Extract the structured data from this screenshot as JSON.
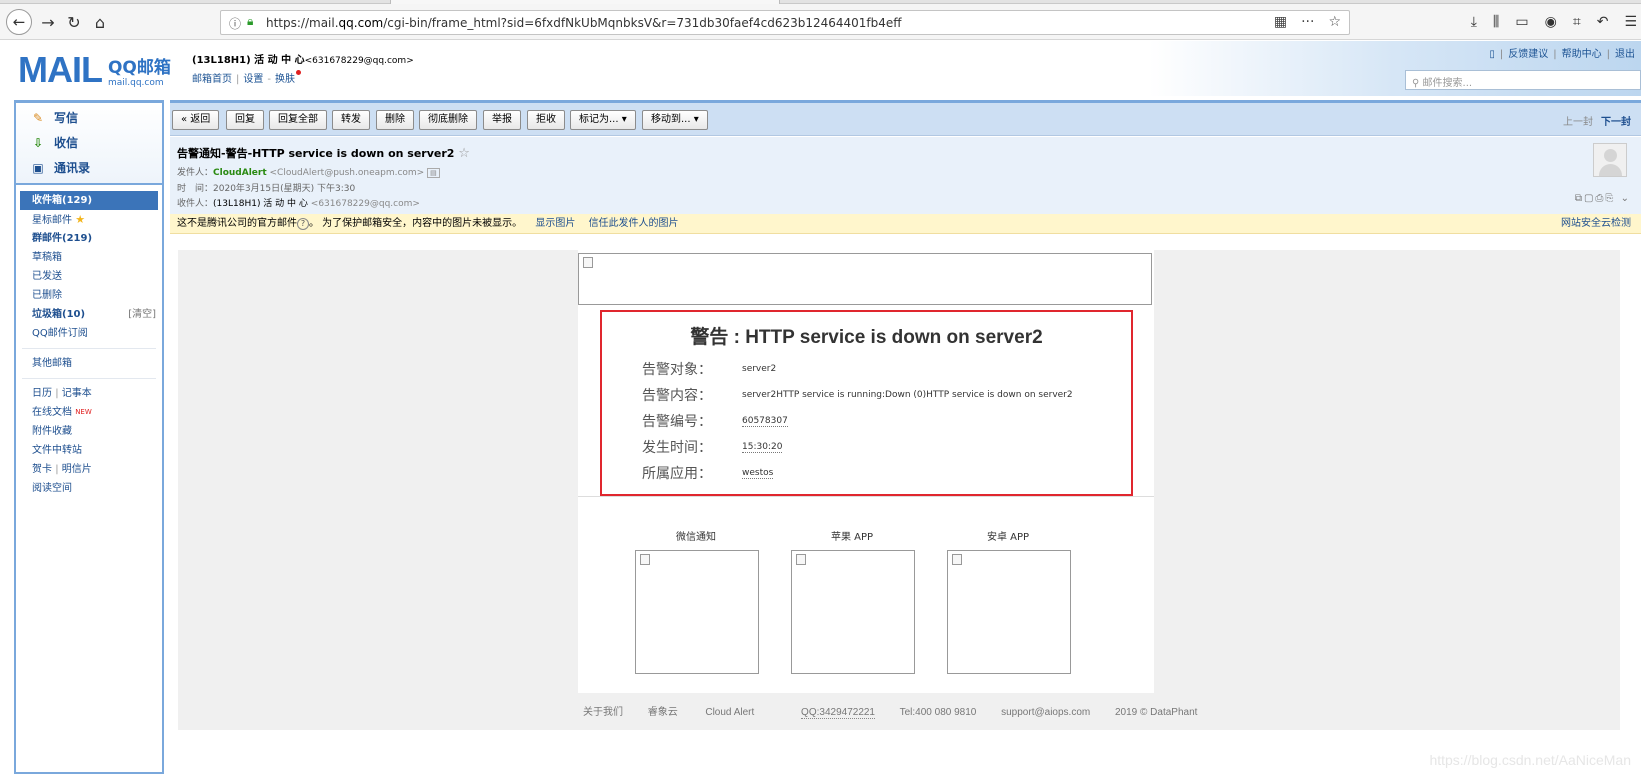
{
  "browser": {
    "url_prefix": "https://mail.",
    "url_domain": "qq.com",
    "url_rest": "/cgi-bin/frame_html?sid=6fxdfNkUbMqnbksV&r=731db30faef4cd623b12464401fb4eff",
    "icons": [
      "back-icon",
      "forward-icon",
      "reload-icon",
      "home-icon",
      "info-icon",
      "lock-icon",
      "qr-icon",
      "more-icon",
      "bookmark-star-icon",
      "download-icon",
      "library-icon",
      "sidebar-icon",
      "sync-icon",
      "crop-icon",
      "undo-icon",
      "menu-icon"
    ]
  },
  "header": {
    "logo_main": "MAIL",
    "logo_cn": "QQ邮箱",
    "logo_domain": "mail.qq.com",
    "user_name": "(13L18H1) 活 动 中 心",
    "user_email": "<631678229@qq.com>",
    "links": [
      "邮箱首页",
      "设置",
      "换肤"
    ],
    "top_links": [
      "反馈建议",
      "帮助中心",
      "退出"
    ],
    "search_placeholder": "邮件搜索..."
  },
  "sidebar": {
    "quick": [
      "写信",
      "收信",
      "通讯录"
    ],
    "inbox": "收件箱(129)",
    "starred": "星标邮件",
    "group": "群邮件(219)",
    "drafts": "草稿箱",
    "sent": "已发送",
    "deleted": "已删除",
    "spam": "垃圾箱(10)",
    "spam_clear": "[清空]",
    "subscription": "QQ邮件订阅",
    "other": "其他邮箱",
    "calendar": "日历",
    "notes": "记事本",
    "docs": "在线文档",
    "docs_badge": "NEW",
    "attachments": "附件收藏",
    "transfer": "文件中转站",
    "cards": "贺卡",
    "postcard": "明信片",
    "reading": "阅读空间"
  },
  "toolbar": {
    "back": "« 返回",
    "reply": "回复",
    "reply_all": "回复全部",
    "forward": "转发",
    "delete": "删除",
    "delete_perm": "彻底删除",
    "report": "举报",
    "reject": "拒收",
    "mark_as": "标记为... ▾",
    "move_to": "移动到... ▾",
    "prev": "上一封",
    "next": "下一封"
  },
  "message": {
    "subject": "告警通知-警告-HTTP service is down on server2",
    "from_label": "发件人：",
    "from_name": "CloudAlert",
    "from_addr": "<CloudAlert@push.oneapm.com>",
    "time_label": "时　间：",
    "time": "2020年3月15日(星期天) 下午3:30",
    "to_label": "收件人：",
    "to_name": "(13L18H1) 活 动 中 心",
    "to_addr": "<631678229@qq.com>"
  },
  "warning": {
    "text_a": "这不是腾讯公司的官方邮件",
    "text_b": "。 为了保护邮箱安全，内容中的图片未被显示。",
    "show_images": "显示图片",
    "trust": "信任此发件人的图片",
    "right": "网站安全云检测"
  },
  "alert": {
    "title": "警告 : HTTP service is down on server2",
    "rows": [
      {
        "k": "告警对象：",
        "v": "server2"
      },
      {
        "k": "告警内容：",
        "v": "server2HTTP service is running:Down (0)HTTP service is down on server2"
      },
      {
        "k": "告警编号：",
        "v": "60578307"
      },
      {
        "k": "发生时间：",
        "v": "15:30:20"
      },
      {
        "k": "所属应用：",
        "v": "westos"
      }
    ],
    "apps": [
      "微信通知",
      "苹果 APP",
      "安卓 APP"
    ]
  },
  "footer": {
    "about": "关于我们",
    "brand_cn": "睿象云",
    "brand": "Cloud Alert",
    "qq": "QQ:3429472221",
    "tel": "Tel:400 080 9810",
    "email": "support@aiops.com",
    "copyright": "2019 © DataPhant"
  },
  "watermark": "https://blog.csdn.net/AaNiceMan"
}
